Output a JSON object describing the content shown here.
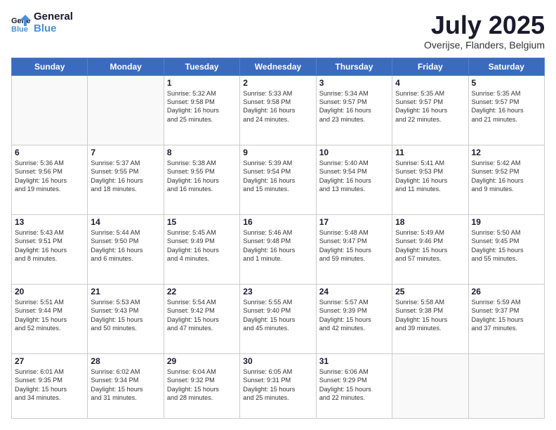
{
  "header": {
    "logo_line1": "General",
    "logo_line2": "Blue",
    "month": "July 2025",
    "location": "Overijse, Flanders, Belgium"
  },
  "weekdays": [
    "Sunday",
    "Monday",
    "Tuesday",
    "Wednesday",
    "Thursday",
    "Friday",
    "Saturday"
  ],
  "weeks": [
    [
      {
        "day": "",
        "text": ""
      },
      {
        "day": "",
        "text": ""
      },
      {
        "day": "1",
        "text": "Sunrise: 5:32 AM\nSunset: 9:58 PM\nDaylight: 16 hours\nand 25 minutes."
      },
      {
        "day": "2",
        "text": "Sunrise: 5:33 AM\nSunset: 9:58 PM\nDaylight: 16 hours\nand 24 minutes."
      },
      {
        "day": "3",
        "text": "Sunrise: 5:34 AM\nSunset: 9:57 PM\nDaylight: 16 hours\nand 23 minutes."
      },
      {
        "day": "4",
        "text": "Sunrise: 5:35 AM\nSunset: 9:57 PM\nDaylight: 16 hours\nand 22 minutes."
      },
      {
        "day": "5",
        "text": "Sunrise: 5:35 AM\nSunset: 9:57 PM\nDaylight: 16 hours\nand 21 minutes."
      }
    ],
    [
      {
        "day": "6",
        "text": "Sunrise: 5:36 AM\nSunset: 9:56 PM\nDaylight: 16 hours\nand 19 minutes."
      },
      {
        "day": "7",
        "text": "Sunrise: 5:37 AM\nSunset: 9:55 PM\nDaylight: 16 hours\nand 18 minutes."
      },
      {
        "day": "8",
        "text": "Sunrise: 5:38 AM\nSunset: 9:55 PM\nDaylight: 16 hours\nand 16 minutes."
      },
      {
        "day": "9",
        "text": "Sunrise: 5:39 AM\nSunset: 9:54 PM\nDaylight: 16 hours\nand 15 minutes."
      },
      {
        "day": "10",
        "text": "Sunrise: 5:40 AM\nSunset: 9:54 PM\nDaylight: 16 hours\nand 13 minutes."
      },
      {
        "day": "11",
        "text": "Sunrise: 5:41 AM\nSunset: 9:53 PM\nDaylight: 16 hours\nand 11 minutes."
      },
      {
        "day": "12",
        "text": "Sunrise: 5:42 AM\nSunset: 9:52 PM\nDaylight: 16 hours\nand 9 minutes."
      }
    ],
    [
      {
        "day": "13",
        "text": "Sunrise: 5:43 AM\nSunset: 9:51 PM\nDaylight: 16 hours\nand 8 minutes."
      },
      {
        "day": "14",
        "text": "Sunrise: 5:44 AM\nSunset: 9:50 PM\nDaylight: 16 hours\nand 6 minutes."
      },
      {
        "day": "15",
        "text": "Sunrise: 5:45 AM\nSunset: 9:49 PM\nDaylight: 16 hours\nand 4 minutes."
      },
      {
        "day": "16",
        "text": "Sunrise: 5:46 AM\nSunset: 9:48 PM\nDaylight: 16 hours\nand 1 minute."
      },
      {
        "day": "17",
        "text": "Sunrise: 5:48 AM\nSunset: 9:47 PM\nDaylight: 15 hours\nand 59 minutes."
      },
      {
        "day": "18",
        "text": "Sunrise: 5:49 AM\nSunset: 9:46 PM\nDaylight: 15 hours\nand 57 minutes."
      },
      {
        "day": "19",
        "text": "Sunrise: 5:50 AM\nSunset: 9:45 PM\nDaylight: 15 hours\nand 55 minutes."
      }
    ],
    [
      {
        "day": "20",
        "text": "Sunrise: 5:51 AM\nSunset: 9:44 PM\nDaylight: 15 hours\nand 52 minutes."
      },
      {
        "day": "21",
        "text": "Sunrise: 5:53 AM\nSunset: 9:43 PM\nDaylight: 15 hours\nand 50 minutes."
      },
      {
        "day": "22",
        "text": "Sunrise: 5:54 AM\nSunset: 9:42 PM\nDaylight: 15 hours\nand 47 minutes."
      },
      {
        "day": "23",
        "text": "Sunrise: 5:55 AM\nSunset: 9:40 PM\nDaylight: 15 hours\nand 45 minutes."
      },
      {
        "day": "24",
        "text": "Sunrise: 5:57 AM\nSunset: 9:39 PM\nDaylight: 15 hours\nand 42 minutes."
      },
      {
        "day": "25",
        "text": "Sunrise: 5:58 AM\nSunset: 9:38 PM\nDaylight: 15 hours\nand 39 minutes."
      },
      {
        "day": "26",
        "text": "Sunrise: 5:59 AM\nSunset: 9:37 PM\nDaylight: 15 hours\nand 37 minutes."
      }
    ],
    [
      {
        "day": "27",
        "text": "Sunrise: 6:01 AM\nSunset: 9:35 PM\nDaylight: 15 hours\nand 34 minutes."
      },
      {
        "day": "28",
        "text": "Sunrise: 6:02 AM\nSunset: 9:34 PM\nDaylight: 15 hours\nand 31 minutes."
      },
      {
        "day": "29",
        "text": "Sunrise: 6:04 AM\nSunset: 9:32 PM\nDaylight: 15 hours\nand 28 minutes."
      },
      {
        "day": "30",
        "text": "Sunrise: 6:05 AM\nSunset: 9:31 PM\nDaylight: 15 hours\nand 25 minutes."
      },
      {
        "day": "31",
        "text": "Sunrise: 6:06 AM\nSunset: 9:29 PM\nDaylight: 15 hours\nand 22 minutes."
      },
      {
        "day": "",
        "text": ""
      },
      {
        "day": "",
        "text": ""
      }
    ]
  ]
}
